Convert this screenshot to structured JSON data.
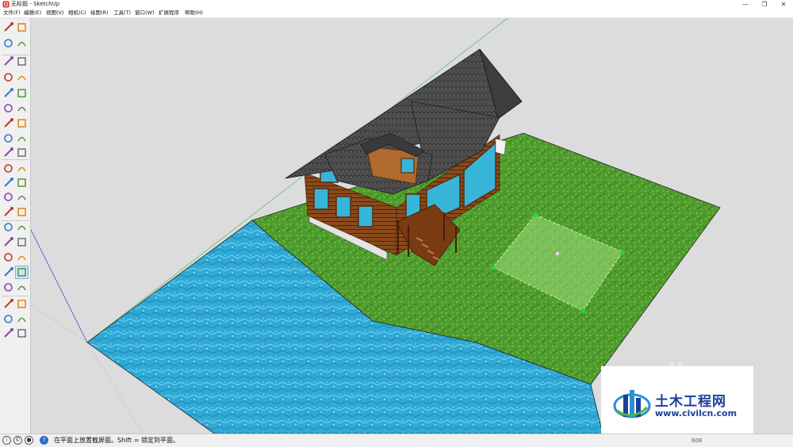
{
  "window": {
    "title": "无标题 - SketchUp",
    "minimize_glyph": "—",
    "restore_glyph": "❐",
    "close_glyph": "✕"
  },
  "menu": [
    {
      "label": "文件(F)"
    },
    {
      "label": "编辑(E)"
    },
    {
      "label": "视图(V)"
    },
    {
      "label": "相机(C)"
    },
    {
      "label": "绘图(R)"
    },
    {
      "label": "工具(T)"
    },
    {
      "label": "窗口(W)"
    },
    {
      "label": "扩展程序"
    },
    {
      "label": "帮助(H)"
    }
  ],
  "toolbar": {
    "tools": [
      {
        "name": "select-tool-icon"
      },
      {
        "name": "make-component-icon"
      },
      {
        "name": "paint-bucket-icon"
      },
      {
        "name": "eraser-icon"
      },
      {
        "name": "line-tool-icon"
      },
      {
        "name": "freehand-tool-icon"
      },
      {
        "name": "rectangle-tool-icon"
      },
      {
        "name": "rotated-rectangle-icon"
      },
      {
        "name": "circle-tool-icon"
      },
      {
        "name": "polygon-tool-icon"
      },
      {
        "name": "arc-tool-icon"
      },
      {
        "name": "two-point-arc-icon"
      },
      {
        "name": "three-point-arc-icon"
      },
      {
        "name": "pie-tool-icon"
      },
      {
        "name": "move-tool-icon"
      },
      {
        "name": "push-pull-icon"
      },
      {
        "name": "rotate-tool-icon"
      },
      {
        "name": "follow-me-icon"
      },
      {
        "name": "scale-tool-icon"
      },
      {
        "name": "offset-tool-icon"
      },
      {
        "name": "tape-measure-icon"
      },
      {
        "name": "dimension-tool-icon"
      },
      {
        "name": "protractor-icon"
      },
      {
        "name": "text-tool-icon"
      },
      {
        "name": "axes-tool-icon"
      },
      {
        "name": "3d-text-icon"
      },
      {
        "name": "orbit-tool-icon"
      },
      {
        "name": "pan-tool-icon"
      },
      {
        "name": "zoom-tool-icon"
      },
      {
        "name": "zoom-window-icon"
      },
      {
        "name": "zoom-extents-icon"
      },
      {
        "name": "previous-view-icon"
      },
      {
        "name": "position-camera-icon"
      },
      {
        "name": "look-around-icon"
      },
      {
        "name": "walk-tool-icon"
      },
      {
        "name": "section-plane-icon"
      },
      {
        "name": "iso-view-icon"
      },
      {
        "name": "top-view-icon"
      },
      {
        "name": "front-view-icon"
      },
      {
        "name": "right-view-icon"
      },
      {
        "name": "back-view-icon"
      },
      {
        "name": "left-view-icon"
      }
    ]
  },
  "status": {
    "text": "在平面上放置截屏面。Shift = 锁定到平面。",
    "value": "608"
  },
  "watermark": {
    "title": "土木工程网",
    "url": "www.civilcn.com"
  },
  "colors": {
    "grass": "#4e9c2e",
    "water": "#2fa9d6",
    "roof": "#4a4a4a",
    "log_wall": "#8a4a1c",
    "brand_blue": "#1b3f9a"
  }
}
